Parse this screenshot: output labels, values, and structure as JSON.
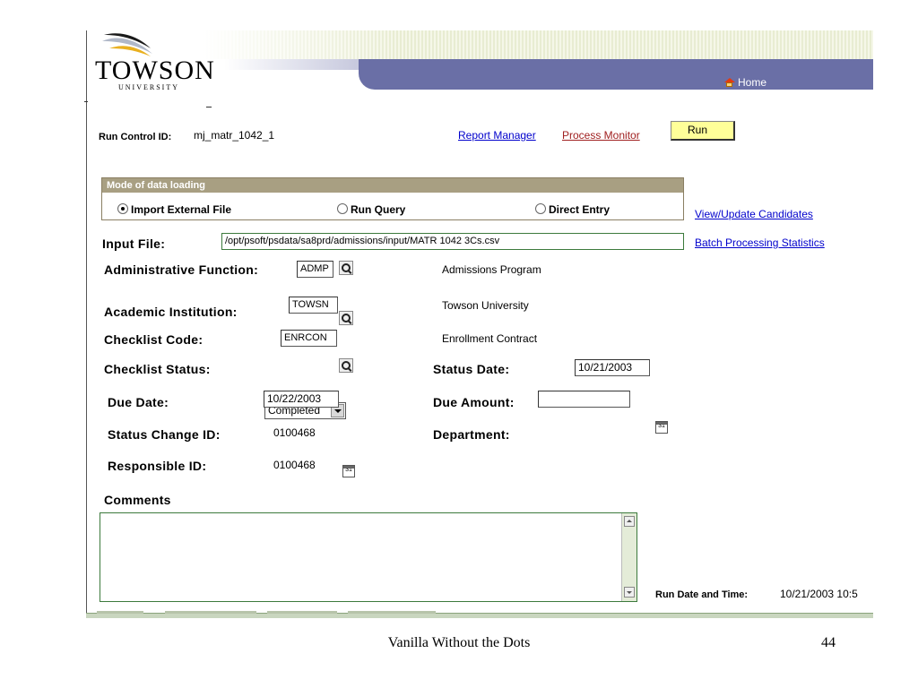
{
  "header": {
    "logo": {
      "name": "TOWSON",
      "sub": "UNIVERSITY"
    },
    "home_label": "Home",
    "colors": {
      "banner_bar": "#6a6fa6",
      "stripes": "#e8ecd2"
    }
  },
  "run_control": {
    "label": "Run Control ID:",
    "value": "mj_matr_1042_1",
    "report_manager": "Report Manager",
    "process_monitor": "Process Monitor",
    "run_button": "Run"
  },
  "mode": {
    "header": "Mode of data loading",
    "options": [
      {
        "label": "Import External File",
        "selected": true
      },
      {
        "label": "Run Query",
        "selected": false
      },
      {
        "label": "Direct Entry",
        "selected": false
      }
    ]
  },
  "side_links": {
    "view_update": "View/Update Candidates",
    "batch_stats": "Batch Processing Statistics"
  },
  "form": {
    "input_file": {
      "label": "Input File:",
      "value": "/opt/psoft/psdata/sa8prd/admissions/input/MATR 1042 3Cs.csv"
    },
    "admin_function": {
      "label": "Administrative Function:",
      "value": "ADMP",
      "description": "Admissions Program"
    },
    "academic_institution": {
      "label": "Academic Institution:",
      "value": "TOWSN",
      "description": "Towson University"
    },
    "checklist_code": {
      "label": "Checklist Code:",
      "value": "ENRCON",
      "description": "Enrollment Contract"
    },
    "checklist_status": {
      "label": "Checklist Status:",
      "value": "Completed"
    },
    "status_date": {
      "label": "Status Date:",
      "value": "10/21/2003"
    },
    "due_date": {
      "label": "Due Date:",
      "value": "10/22/2003"
    },
    "due_amount": {
      "label": "Due Amount:",
      "value": ""
    },
    "status_change_id": {
      "label": "Status Change ID:",
      "value": "0100468"
    },
    "department": {
      "label": "Department:",
      "value": ""
    },
    "responsible_id": {
      "label": "Responsible ID:",
      "value": "0100468"
    },
    "comments": {
      "label": "Comments",
      "value": ""
    },
    "run_date_time": {
      "label": "Run Date and Time:",
      "value": "10/21/2003 10:5"
    }
  },
  "slide_footer": {
    "title": "Vanilla Without the Dots",
    "page": "44"
  }
}
